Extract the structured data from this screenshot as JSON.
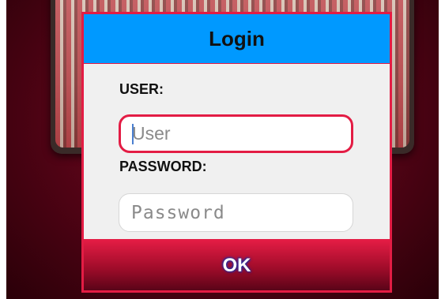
{
  "dialog": {
    "title": "Login",
    "user_label": "USER:",
    "user_placeholder": "User",
    "user_value": "",
    "password_label": "PASSWORD:",
    "password_placeholder": "Password",
    "password_value": "",
    "ok_label": "OK"
  },
  "colors": {
    "header": "#0099ff",
    "accent": "#e31c44",
    "body": "#f0f0f0",
    "background": "#5a0418"
  }
}
